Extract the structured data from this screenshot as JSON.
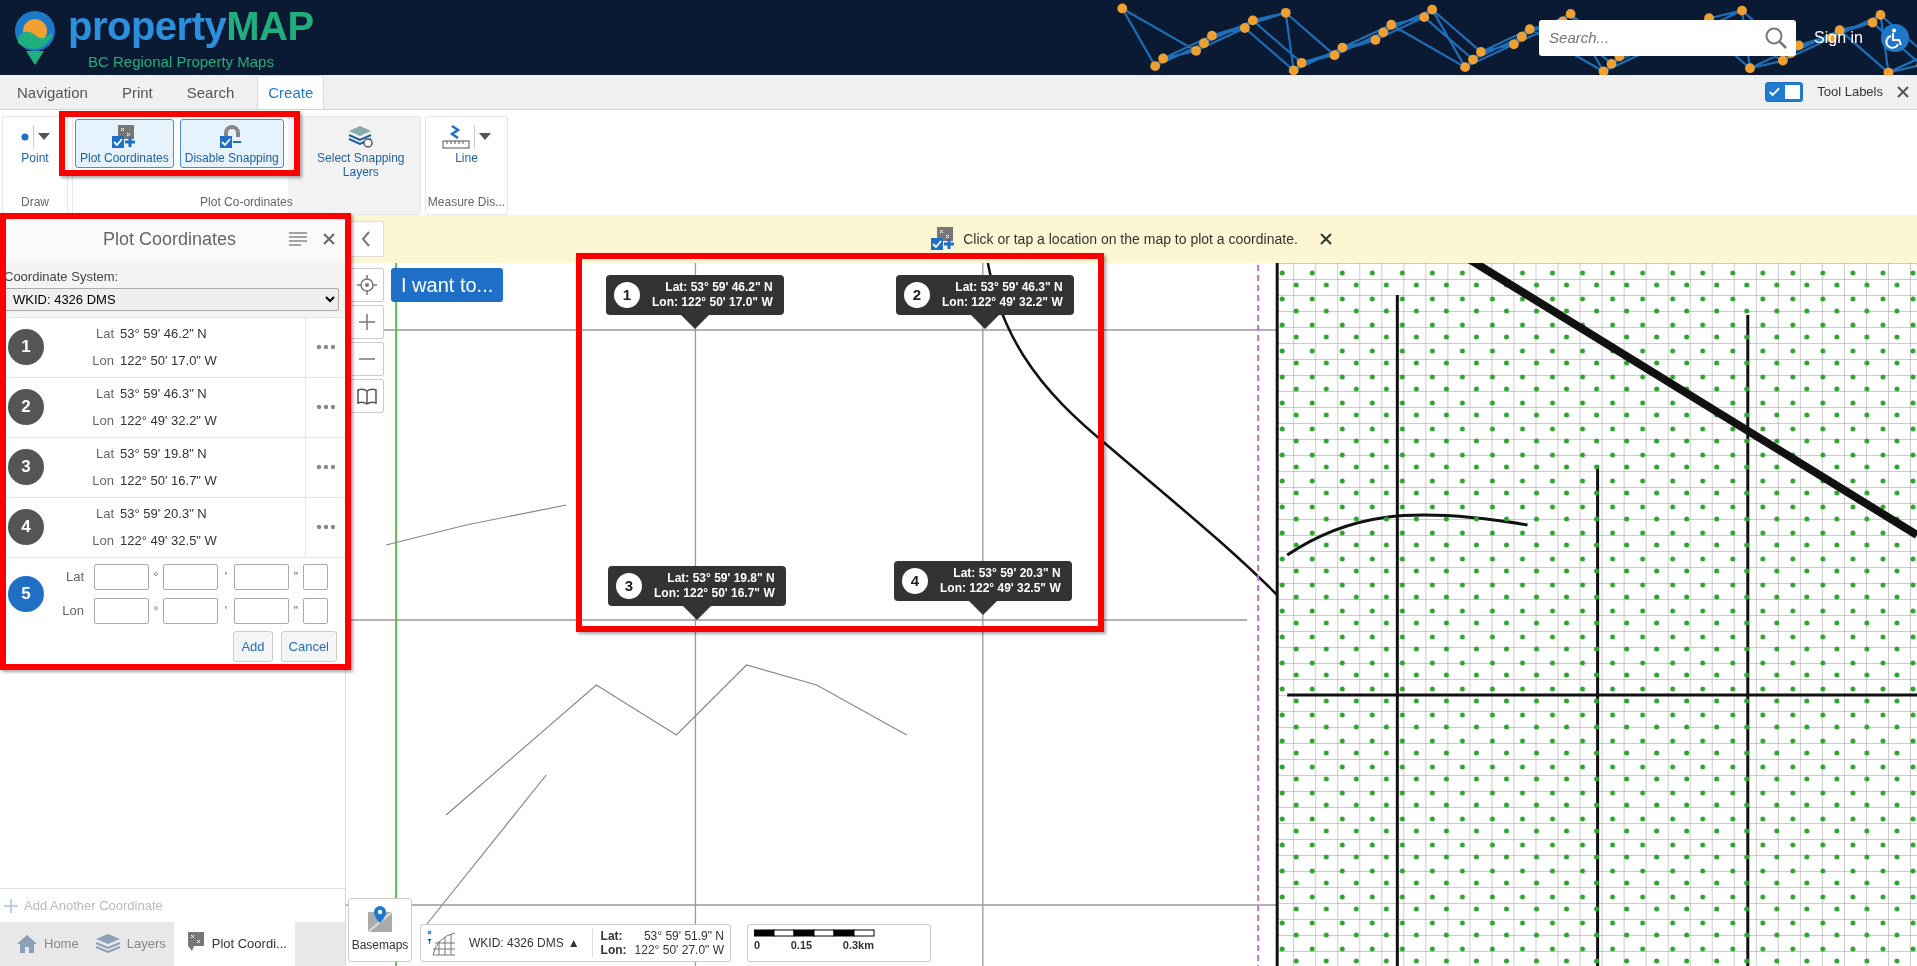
{
  "header": {
    "brand": "property",
    "brand_suffix": "MAP",
    "subtitle": "BC Regional Property Maps",
    "search": {
      "placeholder": "Search..."
    },
    "sign_in": "Sign in"
  },
  "ribbon_tabs": [
    {
      "label": "Navigation",
      "selected": false
    },
    {
      "label": "Print",
      "selected": false
    },
    {
      "label": "Search",
      "selected": false
    },
    {
      "label": "Create",
      "selected": true
    }
  ],
  "tool_labels": {
    "label": "Tool Labels",
    "on": true
  },
  "ribbon_groups": [
    {
      "label": "Draw",
      "tools": [
        {
          "label": "Point",
          "kind": "point",
          "selected": false,
          "dropdown": true
        }
      ]
    },
    {
      "label": "Plot Co-ordinates",
      "tools": [
        {
          "label": "Plot Coordinates",
          "kind": "plot",
          "selected": true,
          "dropdown": false
        },
        {
          "label": "Disable Snapping",
          "kind": "snap",
          "selected": true,
          "dropdown": false
        },
        {
          "label": "Select Snapping Layers",
          "kind": "layers",
          "selected": false,
          "dropdown": false
        }
      ]
    },
    {
      "label": "Measure Dis...",
      "tools": [
        {
          "label": "Line",
          "kind": "line",
          "selected": false,
          "dropdown": true
        }
      ]
    }
  ],
  "panel": {
    "title": "Plot Coordinates",
    "coordinate_system_label": "Coordinate System:",
    "coordinate_system": "WKID: 4326 DMS",
    "points": [
      {
        "number": "1",
        "lat_label": "Lat",
        "lat": "53° 59' 46.2\" N",
        "lon_label": "Lon",
        "lon": "122° 50' 17.0\" W"
      },
      {
        "number": "2",
        "lat_label": "Lat",
        "lat": "53° 59' 46.3\" N",
        "lon_label": "Lon",
        "lon": "122° 49' 32.2\" W"
      },
      {
        "number": "3",
        "lat_label": "Lat",
        "lat": "53° 59' 19.8\" N",
        "lon_label": "Lon",
        "lon": "122° 50' 16.7\" W"
      },
      {
        "number": "4",
        "lat_label": "Lat",
        "lat": "53° 59' 20.3\" N",
        "lon_label": "Lon",
        "lon": "122° 49' 32.5\" W"
      }
    ],
    "new_point": {
      "number": "5",
      "rows": [
        {
          "label": "Lat",
          "marks": [
            "°",
            "'",
            "\""
          ]
        },
        {
          "label": "Lon",
          "marks": [
            "°",
            "'",
            "\""
          ]
        }
      ]
    },
    "buttons": [
      "Add",
      "Cancel"
    ],
    "add_another": "Add Another Coordinate"
  },
  "bottom_tabs": [
    {
      "label": "Home",
      "kind": "home",
      "selected": false
    },
    {
      "label": "Layers",
      "kind": "layers",
      "selected": false
    },
    {
      "label": "Plot Coordi...",
      "kind": "plot",
      "selected": true
    }
  ],
  "notification": {
    "text": "Click or tap a location on the map to plot a coordinate."
  },
  "map": {
    "i_want_to": "I want to...",
    "callouts": [
      {
        "number": "1",
        "lat": "Lat: 53° 59' 46.2\" N",
        "lon": "Lon: 122° 50' 17.0\" W"
      },
      {
        "number": "2",
        "lat": "Lat: 53° 59' 46.3\" N",
        "lon": "Lon: 122° 49' 32.2\" W"
      },
      {
        "number": "3",
        "lat": "Lat: 53° 59' 19.8\" N",
        "lon": "Lon: 122° 50' 16.7\" W"
      },
      {
        "number": "4",
        "lat": "Lat: 53° 59' 20.3\" N",
        "lon": "Lon: 122° 49' 32.5\" W"
      }
    ],
    "basemaps": "Basemaps",
    "coordinates": {
      "system": "WKID: 4326 DMS",
      "toggle": "▲",
      "lat_label": "Lat:",
      "lat": "53° 59' 51.9\" N",
      "lon_label": "Lon:",
      "lon": "122° 50' 27.0\" W"
    },
    "scale": [
      "0",
      "0.15",
      "0.3km"
    ]
  }
}
